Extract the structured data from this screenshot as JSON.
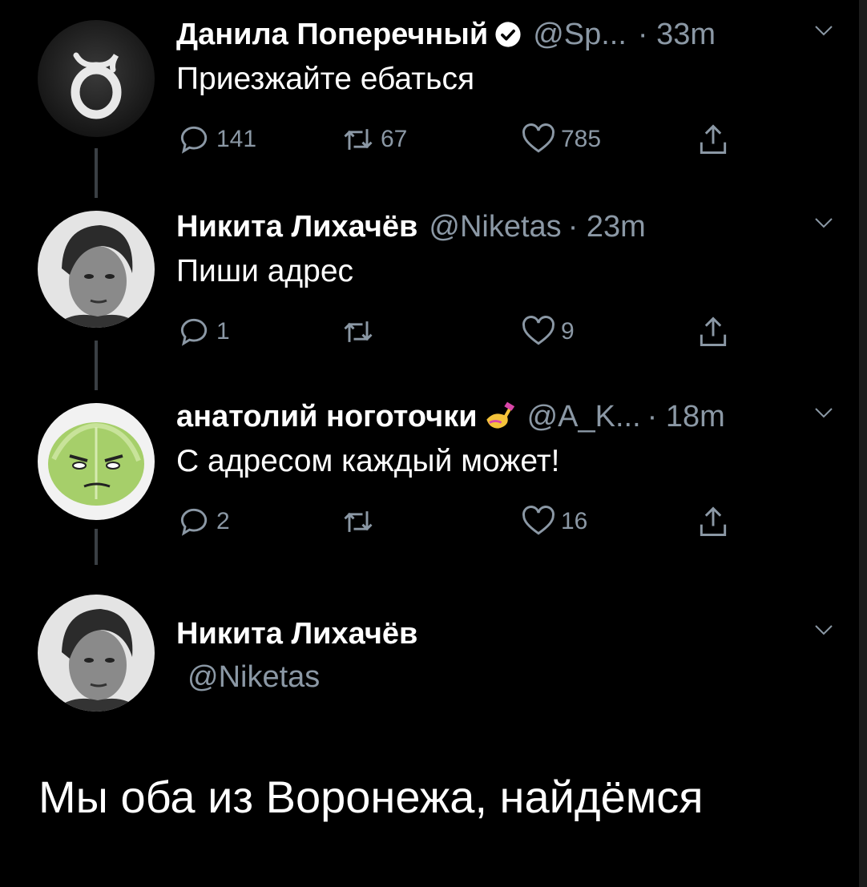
{
  "tweets": [
    {
      "name": "Данила Поперечный",
      "handle": "@Sp...",
      "time": "· 33m",
      "text": "Приезжайте ебаться",
      "replies": "141",
      "retweets": "67",
      "likes": "785",
      "verified": true
    },
    {
      "name": "Никита Лихачёв",
      "handle": "@Niketas",
      "time": "· 23m",
      "text": "Пиши адрес",
      "replies": "1",
      "retweets": "",
      "likes": "9"
    },
    {
      "name": "анатолий ноготочки",
      "handle": "@A_K...",
      "time": "· 18m",
      "text": "С адресом каждый может!",
      "replies": "2",
      "retweets": "",
      "likes": "16",
      "name_emoji": "nail-polish-emoji"
    }
  ],
  "main": {
    "name": "Никита Лихачёв",
    "handle": "@Niketas",
    "text": "Мы оба из Воронежа, найдёмся"
  },
  "colors": {
    "background": "#000000",
    "secondary": "#8b98a5",
    "thread_line": "#3a3f44"
  }
}
